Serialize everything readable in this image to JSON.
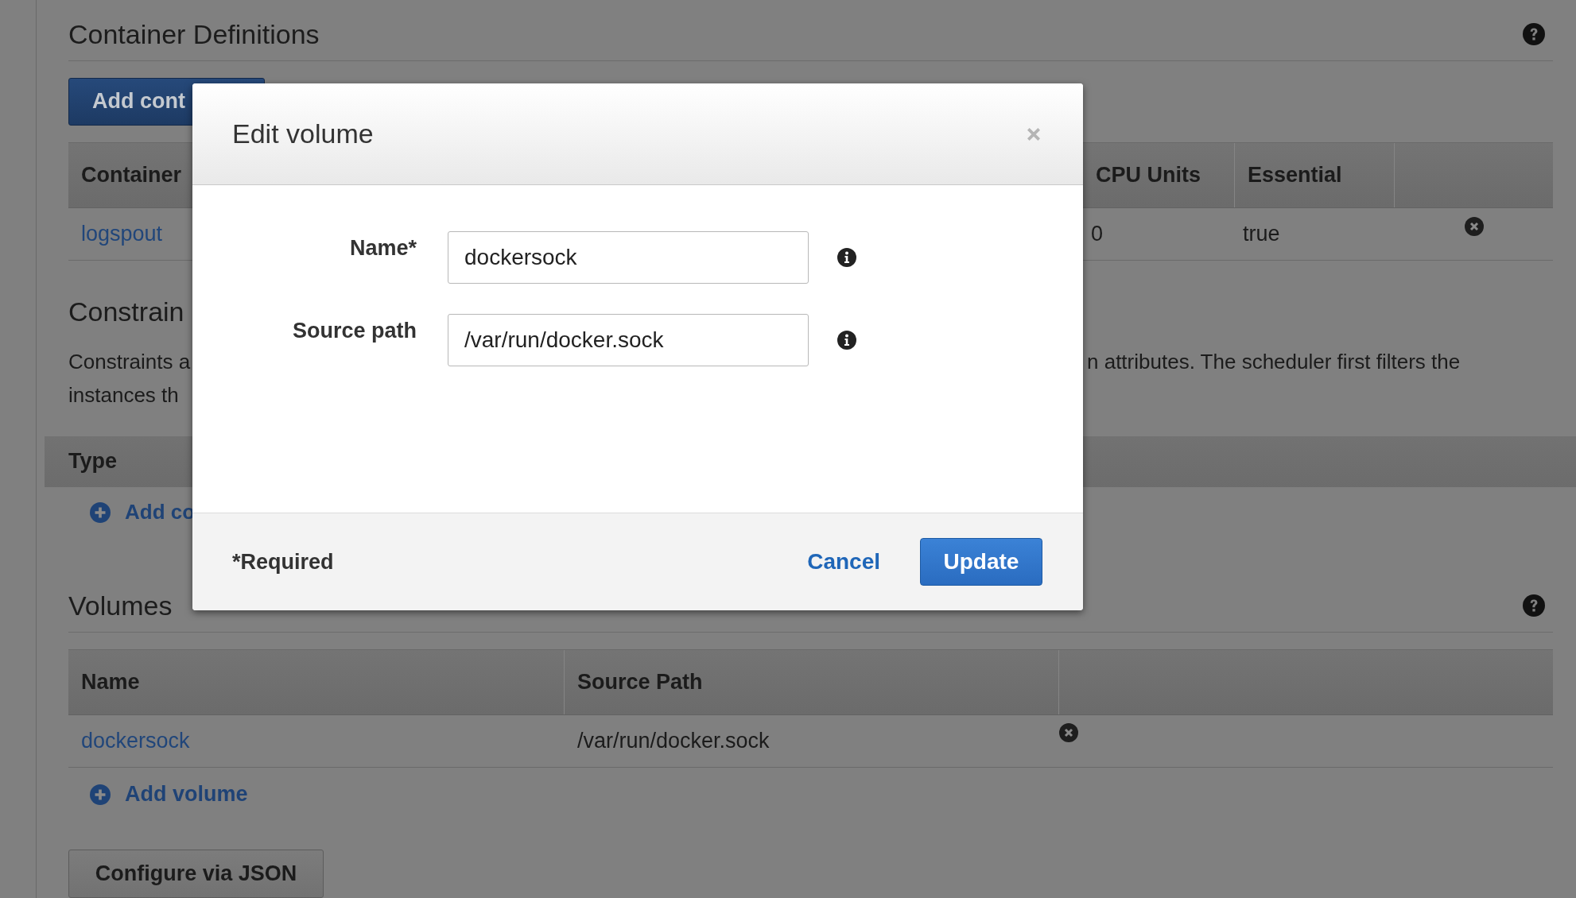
{
  "container_definitions": {
    "title": "Container Definitions",
    "add_button": "Add cont",
    "table": {
      "columns": [
        "Container",
        "CPU Units",
        "Essential"
      ],
      "rows": [
        {
          "cells": [
            "logspout",
            "0",
            "true"
          ]
        }
      ]
    }
  },
  "constraints": {
    "title": "Constrain",
    "description_left": [
      "Constraints a",
      "instances th"
    ],
    "description_right": "n attributes. The scheduler first filters the",
    "table": {
      "columns": [
        "Type"
      ]
    },
    "add_link": "Add co"
  },
  "volumes": {
    "title": "Volumes",
    "table": {
      "columns": [
        "Name",
        "Source Path"
      ],
      "rows": [
        {
          "cells": [
            "dockersock",
            "/var/run/docker.sock"
          ]
        }
      ]
    },
    "add_link": "Add volume"
  },
  "configure_button": "Configure via JSON",
  "modal": {
    "title": "Edit volume",
    "fields": [
      {
        "label": "Name*",
        "value": "dockersock"
      },
      {
        "label": "Source path",
        "value": "/var/run/docker.sock"
      }
    ],
    "required_note": "*Required",
    "cancel": "Cancel",
    "update": "Update"
  }
}
